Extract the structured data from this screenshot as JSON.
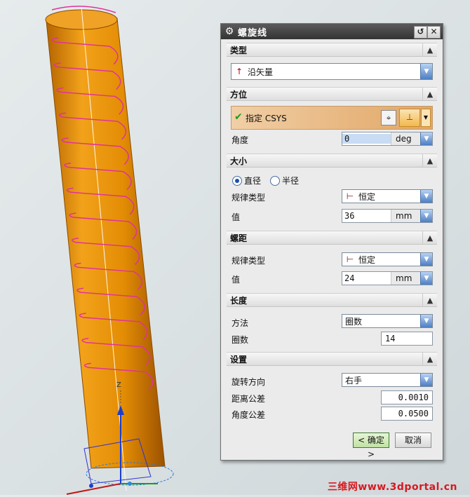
{
  "window": {
    "title": "螺旋线"
  },
  "sections": {
    "type": {
      "header": "类型",
      "vector_option": "沿矢量"
    },
    "orientation": {
      "header": "方位",
      "specify_csys": "指定 CSYS",
      "angle_label": "角度",
      "angle_value": "0",
      "angle_unit": "deg"
    },
    "size": {
      "header": "大小",
      "radio_diameter": "直径",
      "radio_radius": "半径",
      "selected": "直径",
      "law_type_label": "规律类型",
      "law_type_value": "恒定",
      "value_label": "值",
      "value": "36",
      "unit": "mm"
    },
    "pitch": {
      "header": "螺距",
      "law_type_label": "规律类型",
      "law_type_value": "恒定",
      "value_label": "值",
      "value": "24",
      "unit": "mm"
    },
    "length": {
      "header": "长度",
      "method_label": "方法",
      "method_value": "圈数",
      "turns_label": "圈数",
      "turns_value": "14"
    },
    "settings": {
      "header": "设置",
      "rotation_label": "旋转方向",
      "rotation_value": "右手",
      "dist_tol_label": "距离公差",
      "dist_tol_value": "0.0010",
      "angle_tol_label": "角度公差",
      "angle_tol_value": "0.0500"
    }
  },
  "buttons": {
    "ok": "< 确定 >",
    "cancel": "取消"
  },
  "viewport": {
    "axis_label": "Z"
  },
  "watermark": "三维网www.3dportal.cn",
  "colors": {
    "cylinder": "#e88a00",
    "helix": "#e0339a",
    "accent": "#4d7fc4"
  }
}
